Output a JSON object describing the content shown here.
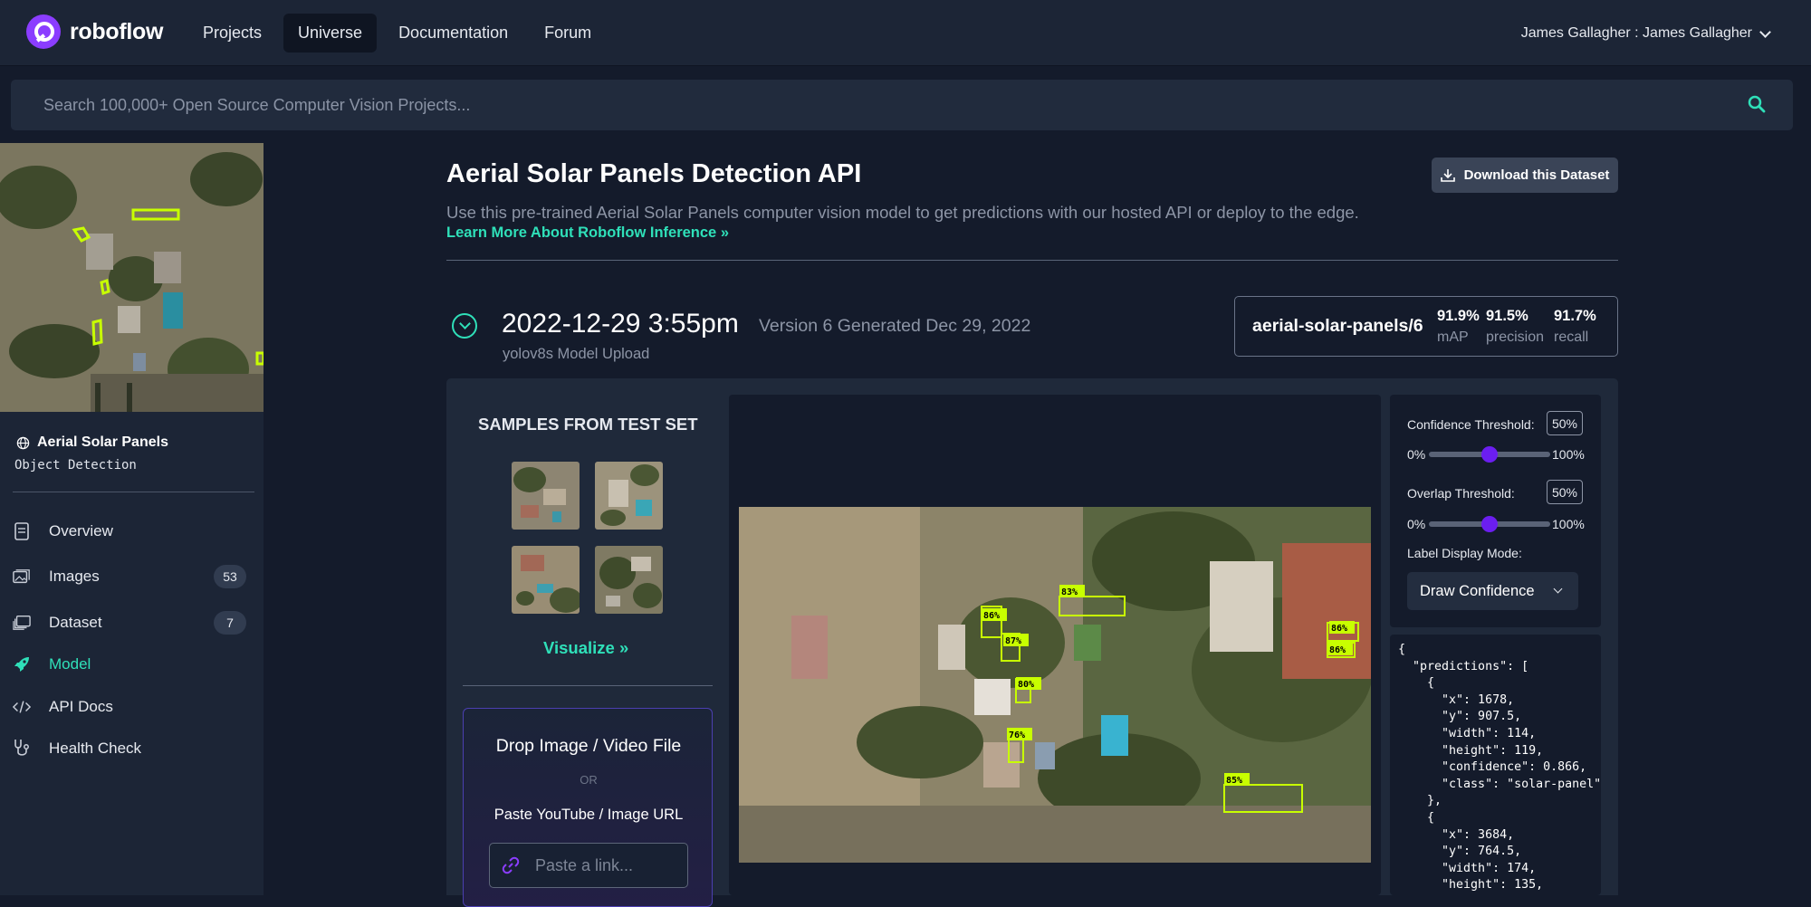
{
  "nav": {
    "brand": "roboflow",
    "links": [
      "Projects",
      "Universe",
      "Documentation",
      "Forum"
    ],
    "active": "Universe",
    "user": "James Gallagher : James Gallagher"
  },
  "search": {
    "placeholder": "Search 100,000+ Open Source Computer Vision Projects..."
  },
  "sidebar": {
    "project_name": "Aerial Solar Panels",
    "project_type": "Object Detection",
    "items": [
      {
        "label": "Overview",
        "icon": "document-icon"
      },
      {
        "label": "Images",
        "icon": "images-icon",
        "badge": "53"
      },
      {
        "label": "Dataset",
        "icon": "dataset-icon",
        "badge": "7"
      },
      {
        "label": "Model",
        "icon": "rocket-icon",
        "active": true
      },
      {
        "label": "API Docs",
        "icon": "code-icon"
      },
      {
        "label": "Health Check",
        "icon": "stethoscope-icon"
      }
    ]
  },
  "main": {
    "title": "Aerial Solar Panels Detection API",
    "subtitle": "Use this pre-trained Aerial Solar Panels computer vision model to get predictions with our hosted API or deploy to the edge.",
    "learn_more": "Learn More About Roboflow Inference »",
    "download_label": "Download this Dataset"
  },
  "version": {
    "date": "2022-12-29 3:55pm",
    "generated": "Version 6 Generated Dec 29, 2022",
    "upload": "yolov8s Model Upload",
    "model_id": "aerial-solar-panels/6",
    "metrics": [
      {
        "value": "91.9%",
        "label": "mAP"
      },
      {
        "value": "91.5%",
        "label": "precision"
      },
      {
        "value": "91.7%",
        "label": "recall"
      }
    ]
  },
  "samples": {
    "title": "SAMPLES FROM TEST SET",
    "visualize": "Visualize »"
  },
  "drop": {
    "title": "Drop Image / Video File",
    "or": "OR",
    "paste_label": "Paste YouTube / Image URL",
    "placeholder": "Paste a link..."
  },
  "detections": [
    "83%",
    "86%",
    "87%",
    "80%",
    "76%",
    "85%",
    "86%",
    "86%"
  ],
  "controls": {
    "confidence_label": "Confidence Threshold:",
    "confidence_value": "50%",
    "overlap_label": "Overlap Threshold:",
    "overlap_value": "50%",
    "min_label": "0%",
    "max_label": "100%",
    "confidence_level": 0.5,
    "overlap_level": 0.5,
    "mode_label": "Label Display Mode:",
    "mode_value": "Draw Confidence"
  },
  "json_output": "{\n  \"predictions\": [\n    {\n      \"x\": 1678,\n      \"y\": 907.5,\n      \"width\": 114,\n      \"height\": 119,\n      \"confidence\": 0.866,\n      \"class\": \"solar-panel\"\n    },\n    {\n      \"x\": 3684,\n      \"y\": 764.5,\n      \"width\": 174,\n      \"height\": 135,",
  "colors": {
    "accent": "#2fe0b9",
    "brand": "#8b3dff",
    "box": "#c8ff00",
    "slider": "#6b1ef0"
  }
}
